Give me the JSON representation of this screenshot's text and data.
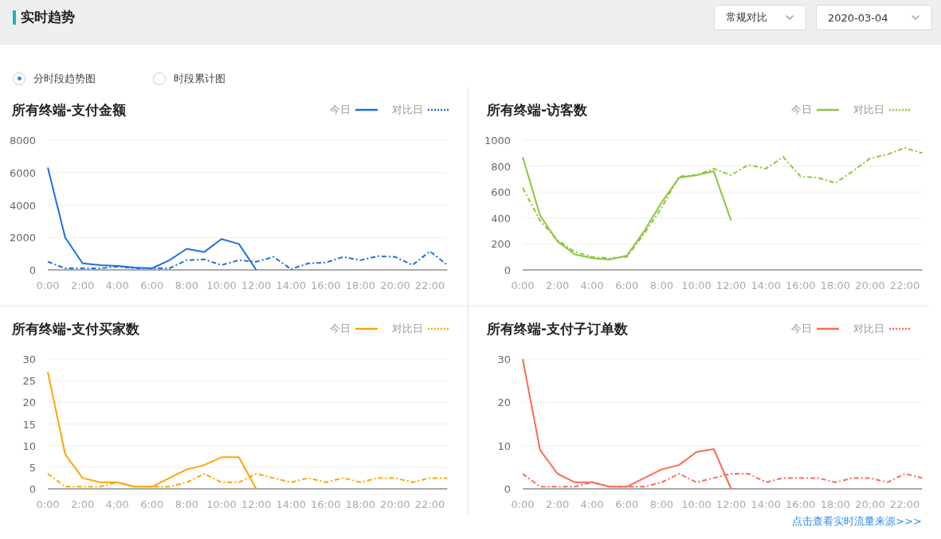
{
  "header": {
    "title": "实时趋势",
    "dropdowns": [
      {
        "value": "常规对比"
      },
      {
        "value": "2020-03-04"
      }
    ]
  },
  "view_options": [
    {
      "label": "分时段趋势图",
      "selected": true
    },
    {
      "label": "时段累计图",
      "selected": false
    }
  ],
  "panels": [
    {
      "title": "所有终端-支付金额",
      "chart_data": {
        "type": "line",
        "grid": true,
        "x": [
          0,
          1,
          2,
          3,
          4,
          5,
          6,
          7,
          8,
          9,
          10,
          11,
          12,
          13,
          14,
          15,
          16,
          17,
          18,
          19,
          20,
          21,
          22,
          23
        ],
        "xlim": [
          0,
          23
        ],
        "ylim": [
          0,
          8000
        ],
        "yticks": [
          0,
          2000,
          4000,
          6000,
          8000
        ],
        "xticks": [
          {
            "value": 0,
            "label": "0:00"
          },
          {
            "value": 2,
            "label": "2:00"
          },
          {
            "value": 4,
            "label": "4:00"
          },
          {
            "value": 6,
            "label": "6:00"
          },
          {
            "value": 8,
            "label": "8:00"
          },
          {
            "value": 10,
            "label": "10:00"
          },
          {
            "value": 12,
            "label": "12:00"
          },
          {
            "value": 14,
            "label": "14:00"
          },
          {
            "value": 16,
            "label": "16:00"
          },
          {
            "value": 18,
            "label": "18:00"
          },
          {
            "value": 20,
            "label": "20:00"
          },
          {
            "value": 22,
            "label": "22:00"
          }
        ],
        "series": [
          {
            "name": "今日",
            "color": "#1f6fe0",
            "line_style": "solid",
            "values": [
              6300,
              2000,
              400,
              300,
              250,
              150,
              100,
              600,
              1300,
              1100,
              1900,
              1600,
              0,
              null,
              null,
              null,
              null,
              null,
              null,
              null,
              null,
              null,
              null,
              null
            ]
          },
          {
            "name": "对比日",
            "color": "#1f6fe0",
            "line_style": "dashdot",
            "values": [
              500,
              100,
              100,
              100,
              200,
              100,
              100,
              100,
              600,
              650,
              300,
              600,
              500,
              800,
              50,
              400,
              450,
              800,
              600,
              850,
              800,
              300,
              1150,
              300
            ]
          }
        ]
      }
    },
    {
      "title": "所有终端-访客数",
      "chart_data": {
        "type": "line",
        "grid": true,
        "x": [
          0,
          1,
          2,
          3,
          4,
          5,
          6,
          7,
          8,
          9,
          10,
          11,
          12,
          13,
          14,
          15,
          16,
          17,
          18,
          19,
          20,
          21,
          22,
          23
        ],
        "xlim": [
          0,
          23
        ],
        "ylim": [
          0,
          1000
        ],
        "yticks": [
          0,
          200,
          400,
          600,
          800,
          1000
        ],
        "xticks": [
          {
            "value": 0,
            "label": "0:00"
          },
          {
            "value": 2,
            "label": "2:00"
          },
          {
            "value": 4,
            "label": "4:00"
          },
          {
            "value": 6,
            "label": "6:00"
          },
          {
            "value": 8,
            "label": "8:00"
          },
          {
            "value": 10,
            "label": "10:00"
          },
          {
            "value": 12,
            "label": "12:00"
          },
          {
            "value": 14,
            "label": "14:00"
          },
          {
            "value": 16,
            "label": "16:00"
          },
          {
            "value": 18,
            "label": "18:00"
          },
          {
            "value": 20,
            "label": "20:00"
          },
          {
            "value": 22,
            "label": "22:00"
          }
        ],
        "series": [
          {
            "name": "今日",
            "color": "#8cc63f",
            "line_style": "solid",
            "values": [
              870,
              420,
              220,
              120,
              90,
              80,
              110,
              300,
              520,
              710,
              730,
              760,
              380,
              null,
              null,
              null,
              null,
              null,
              null,
              null,
              null,
              null,
              null,
              null
            ]
          },
          {
            "name": "对比日",
            "color": "#8cc63f",
            "line_style": "dashdot",
            "values": [
              630,
              380,
              230,
              140,
              100,
              90,
              100,
              280,
              480,
              720,
              730,
              780,
              730,
              810,
              780,
              870,
              720,
              710,
              670,
              760,
              860,
              890,
              940,
              900
            ]
          }
        ]
      }
    },
    {
      "title": "所有终端-支付买家数",
      "chart_data": {
        "type": "line",
        "grid": true,
        "x": [
          0,
          1,
          2,
          3,
          4,
          5,
          6,
          7,
          8,
          9,
          10,
          11,
          12,
          13,
          14,
          15,
          16,
          17,
          18,
          19,
          20,
          21,
          22,
          23
        ],
        "xlim": [
          0,
          23
        ],
        "ylim": [
          0,
          30
        ],
        "yticks": [
          0,
          5,
          10,
          15,
          20,
          25,
          30
        ],
        "xticks": [
          {
            "value": 0,
            "label": "0:00"
          },
          {
            "value": 2,
            "label": "2:00"
          },
          {
            "value": 4,
            "label": "4:00"
          },
          {
            "value": 6,
            "label": "6:00"
          },
          {
            "value": 8,
            "label": "8:00"
          },
          {
            "value": 10,
            "label": "10:00"
          },
          {
            "value": 12,
            "label": "12:00"
          },
          {
            "value": 14,
            "label": "14:00"
          },
          {
            "value": 16,
            "label": "16:00"
          },
          {
            "value": 18,
            "label": "18:00"
          },
          {
            "value": 20,
            "label": "20:00"
          },
          {
            "value": 22,
            "label": "22:00"
          }
        ],
        "series": [
          {
            "name": "今日",
            "color": "#ffa500",
            "line_style": "solid",
            "values": [
              27,
              8,
              2.5,
              1.5,
              1.5,
              0.5,
              0.5,
              2.5,
              4.5,
              5.5,
              7.3,
              7.3,
              0,
              null,
              null,
              null,
              null,
              null,
              null,
              null,
              null,
              null,
              null,
              null
            ]
          },
          {
            "name": "对比日",
            "color": "#ffa500",
            "line_style": "dashdot",
            "values": [
              3.5,
              0.5,
              0.5,
              0.5,
              1.5,
              0.5,
              0.5,
              0.5,
              1.5,
              3.5,
              1.5,
              1.5,
              3.5,
              2.5,
              1.5,
              2.5,
              1.5,
              2.5,
              1.5,
              2.5,
              2.5,
              1.5,
              2.5,
              2.5
            ]
          }
        ]
      }
    },
    {
      "title": "所有终端-支付子订单数",
      "chart_data": {
        "type": "line",
        "grid": true,
        "x": [
          0,
          1,
          2,
          3,
          4,
          5,
          6,
          7,
          8,
          9,
          10,
          11,
          12,
          13,
          14,
          15,
          16,
          17,
          18,
          19,
          20,
          21,
          22,
          23
        ],
        "xlim": [
          0,
          23
        ],
        "ylim": [
          0,
          30
        ],
        "yticks": [
          0,
          10,
          20,
          30
        ],
        "xticks": [
          {
            "value": 0,
            "label": "0:00"
          },
          {
            "value": 2,
            "label": "2:00"
          },
          {
            "value": 4,
            "label": "4:00"
          },
          {
            "value": 6,
            "label": "6:00"
          },
          {
            "value": 8,
            "label": "8:00"
          },
          {
            "value": 10,
            "label": "10:00"
          },
          {
            "value": 12,
            "label": "12:00"
          },
          {
            "value": 14,
            "label": "14:00"
          },
          {
            "value": 16,
            "label": "16:00"
          },
          {
            "value": 18,
            "label": "18:00"
          },
          {
            "value": 20,
            "label": "20:00"
          },
          {
            "value": 22,
            "label": "22:00"
          }
        ],
        "series": [
          {
            "name": "今日",
            "color": "#fa6a55",
            "line_style": "solid",
            "values": [
              30,
              9,
              3.5,
              1.5,
              1.5,
              0.5,
              0.5,
              2.5,
              4.5,
              5.5,
              8.5,
              9.2,
              0,
              null,
              null,
              null,
              null,
              null,
              null,
              null,
              null,
              null,
              null,
              null
            ]
          },
          {
            "name": "对比日",
            "color": "#fa6a55",
            "line_style": "dashdot",
            "values": [
              3.5,
              0.5,
              0.5,
              0.5,
              1.5,
              0.5,
              0.5,
              0.5,
              1.5,
              3.5,
              1.5,
              2.5,
              3.5,
              3.5,
              1.5,
              2.5,
              2.5,
              2.5,
              1.5,
              2.5,
              2.5,
              1.5,
              3.5,
              2.5
            ]
          }
        ]
      }
    }
  ],
  "footer_link": "点击查看实时流量来源>>>"
}
